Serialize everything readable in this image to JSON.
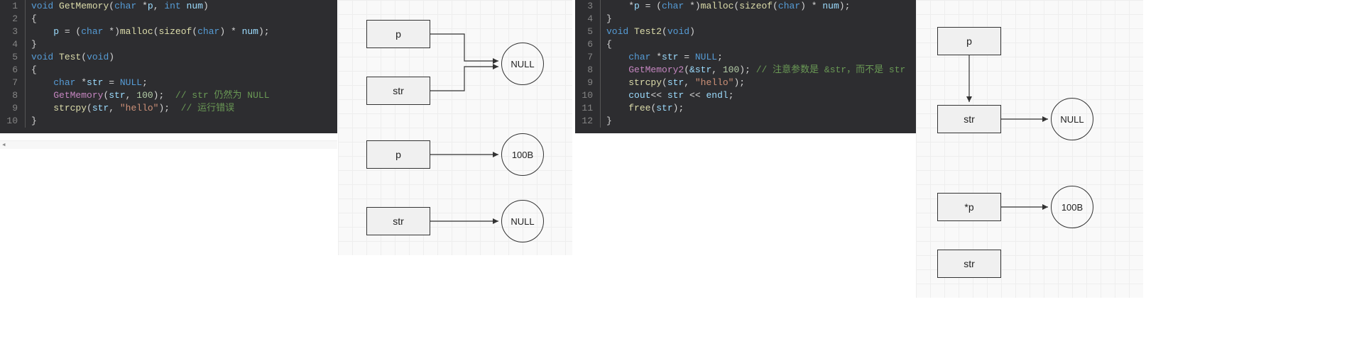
{
  "code1": {
    "lines": [
      {
        "n": "1",
        "tokens": [
          [
            "kw",
            "void"
          ],
          [
            "op",
            " "
          ],
          [
            "fn",
            "GetMemory"
          ],
          [
            "op",
            "("
          ],
          [
            "kw",
            "char"
          ],
          [
            "op",
            " *"
          ],
          [
            "id",
            "p"
          ],
          [
            "op",
            ", "
          ],
          [
            "kw",
            "int"
          ],
          [
            "op",
            " "
          ],
          [
            "id",
            "num"
          ],
          [
            "op",
            ")"
          ]
        ]
      },
      {
        "n": "2",
        "tokens": [
          [
            "op",
            "{"
          ]
        ]
      },
      {
        "n": "3",
        "tokens": [
          [
            "op",
            "    "
          ],
          [
            "id",
            "p"
          ],
          [
            "op",
            " = ("
          ],
          [
            "kw",
            "char"
          ],
          [
            "op",
            " *)"
          ],
          [
            "ml",
            "malloc"
          ],
          [
            "op",
            "("
          ],
          [
            "ml",
            "sizeof"
          ],
          [
            "op",
            "("
          ],
          [
            "kw",
            "char"
          ],
          [
            "op",
            ") * "
          ],
          [
            "id",
            "num"
          ],
          [
            "op",
            ");"
          ]
        ]
      },
      {
        "n": "4",
        "tokens": [
          [
            "op",
            "}"
          ]
        ]
      },
      {
        "n": "5",
        "tokens": [
          [
            "kw",
            "void"
          ],
          [
            "op",
            " "
          ],
          [
            "fn",
            "Test"
          ],
          [
            "op",
            "("
          ],
          [
            "kw",
            "void"
          ],
          [
            "op",
            ")"
          ]
        ]
      },
      {
        "n": "6",
        "tokens": [
          [
            "op",
            "{"
          ]
        ]
      },
      {
        "n": "7",
        "tokens": [
          [
            "op",
            "    "
          ],
          [
            "kw",
            "char"
          ],
          [
            "op",
            " *"
          ],
          [
            "id",
            "str"
          ],
          [
            "op",
            " = "
          ],
          [
            "kw",
            "NULL"
          ],
          [
            "op",
            ";"
          ]
        ]
      },
      {
        "n": "8",
        "tokens": [
          [
            "op",
            "    "
          ],
          [
            "fn2",
            "GetMemory"
          ],
          [
            "op",
            "("
          ],
          [
            "id",
            "str"
          ],
          [
            "op",
            ", "
          ],
          [
            "nm",
            "100"
          ],
          [
            "op",
            ");  "
          ],
          [
            "cm",
            "// str 仍然为 NULL"
          ]
        ]
      },
      {
        "n": "9",
        "tokens": [
          [
            "op",
            "    "
          ],
          [
            "ml",
            "strcpy"
          ],
          [
            "op",
            "("
          ],
          [
            "id",
            "str"
          ],
          [
            "op",
            ", "
          ],
          [
            "st",
            "\"hello\""
          ],
          [
            "op",
            ");  "
          ],
          [
            "cm",
            "// 运行错误"
          ]
        ]
      },
      {
        "n": "10",
        "tokens": [
          [
            "op",
            "}"
          ]
        ]
      }
    ]
  },
  "code2": {
    "lines": [
      {
        "n": "3",
        "tokens": [
          [
            "op",
            "    *"
          ],
          [
            "id",
            "p"
          ],
          [
            "op",
            " = ("
          ],
          [
            "kw",
            "char"
          ],
          [
            "op",
            " *)"
          ],
          [
            "ml",
            "malloc"
          ],
          [
            "op",
            "("
          ],
          [
            "ml",
            "sizeof"
          ],
          [
            "op",
            "("
          ],
          [
            "kw",
            "char"
          ],
          [
            "op",
            ") * "
          ],
          [
            "id",
            "num"
          ],
          [
            "op",
            ");"
          ]
        ]
      },
      {
        "n": "4",
        "tokens": [
          [
            "op",
            "}"
          ]
        ]
      },
      {
        "n": "5",
        "tokens": [
          [
            "kw",
            "void"
          ],
          [
            "op",
            " "
          ],
          [
            "fn",
            "Test2"
          ],
          [
            "op",
            "("
          ],
          [
            "kw",
            "void"
          ],
          [
            "op",
            ")"
          ]
        ]
      },
      {
        "n": "6",
        "tokens": [
          [
            "op",
            "{"
          ]
        ]
      },
      {
        "n": "7",
        "tokens": [
          [
            "op",
            "    "
          ],
          [
            "kw",
            "char"
          ],
          [
            "op",
            " *"
          ],
          [
            "id",
            "str"
          ],
          [
            "op",
            " = "
          ],
          [
            "kw",
            "NULL"
          ],
          [
            "op",
            ";"
          ]
        ]
      },
      {
        "n": "8",
        "tokens": [
          [
            "op",
            "    "
          ],
          [
            "fn2",
            "GetMemory2"
          ],
          [
            "op",
            "("
          ],
          [
            "id",
            "&str"
          ],
          [
            "op",
            ", "
          ],
          [
            "nm",
            "100"
          ],
          [
            "op",
            "); "
          ],
          [
            "cm",
            "// 注意参数是 &str，而不是 str"
          ]
        ]
      },
      {
        "n": "9",
        "tokens": [
          [
            "op",
            "    "
          ],
          [
            "ml",
            "strcpy"
          ],
          [
            "op",
            "("
          ],
          [
            "id",
            "str"
          ],
          [
            "op",
            ", "
          ],
          [
            "st",
            "\"hello\""
          ],
          [
            "op",
            ");"
          ]
        ]
      },
      {
        "n": "10",
        "tokens": [
          [
            "op",
            "    "
          ],
          [
            "id",
            "cout"
          ],
          [
            "op",
            "<< "
          ],
          [
            "id",
            "str"
          ],
          [
            "op",
            " << "
          ],
          [
            "id",
            "endl"
          ],
          [
            "op",
            ";"
          ]
        ]
      },
      {
        "n": "11",
        "tokens": [
          [
            "op",
            "    "
          ],
          [
            "ml",
            "free"
          ],
          [
            "op",
            "("
          ],
          [
            "id",
            "str"
          ],
          [
            "op",
            ");"
          ]
        ]
      },
      {
        "n": "12",
        "tokens": [
          [
            "op",
            "}"
          ]
        ]
      }
    ]
  },
  "scroll": {
    "arrow": "◂"
  },
  "dg1": {
    "boxes": {
      "p_top": "p",
      "str_top": "str",
      "p_bottom": "p",
      "str_bottom": "str"
    },
    "circles": {
      "null_top": "NULL",
      "b100": "100B",
      "null_bottom": "NULL"
    }
  },
  "dg2": {
    "boxes": {
      "p": "p",
      "str": "str",
      "star_p": "*p",
      "str_bottom": "str"
    },
    "circles": {
      "null": "NULL",
      "b100": "100B"
    }
  }
}
